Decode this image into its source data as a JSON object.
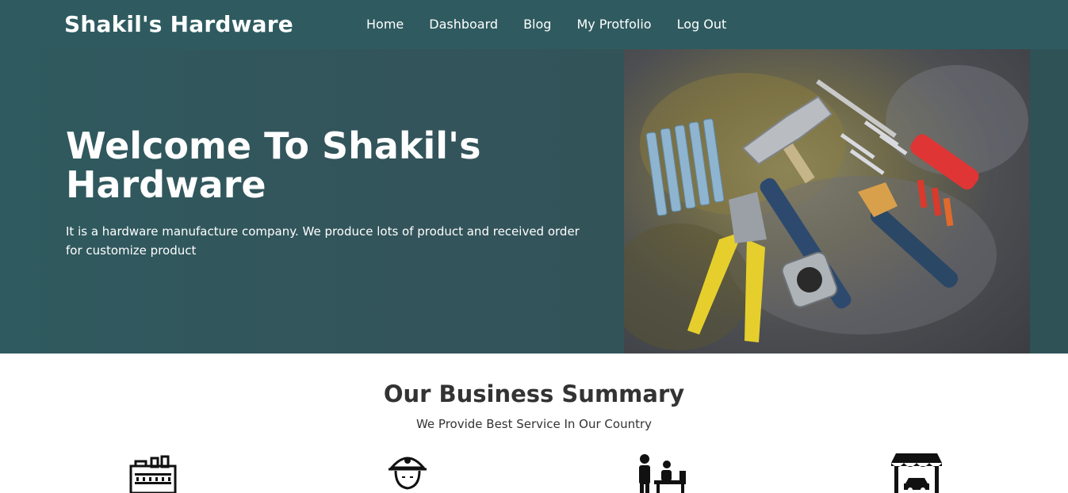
{
  "navbar": {
    "brand": "Shakil's Hardware",
    "links": [
      "Home",
      "Dashboard",
      "Blog",
      "My Protfolio",
      "Log Out"
    ]
  },
  "hero": {
    "title": "Welcome To Shakil's Hardware",
    "description": "It is a hardware manufacture company. We produce lots of product and received order for customize product",
    "image_icon": "hardware-tools-image"
  },
  "summary": {
    "title": "Our Business Summary",
    "subtitle": "We Provide Best Service In Our Country",
    "icons": [
      "factory-icon",
      "worker-icon",
      "customers-icon",
      "shop-icon"
    ]
  },
  "colors": {
    "navbar_bg": "#2f5b60",
    "hero_bg": "#33545a",
    "heading_text": "#333333"
  }
}
